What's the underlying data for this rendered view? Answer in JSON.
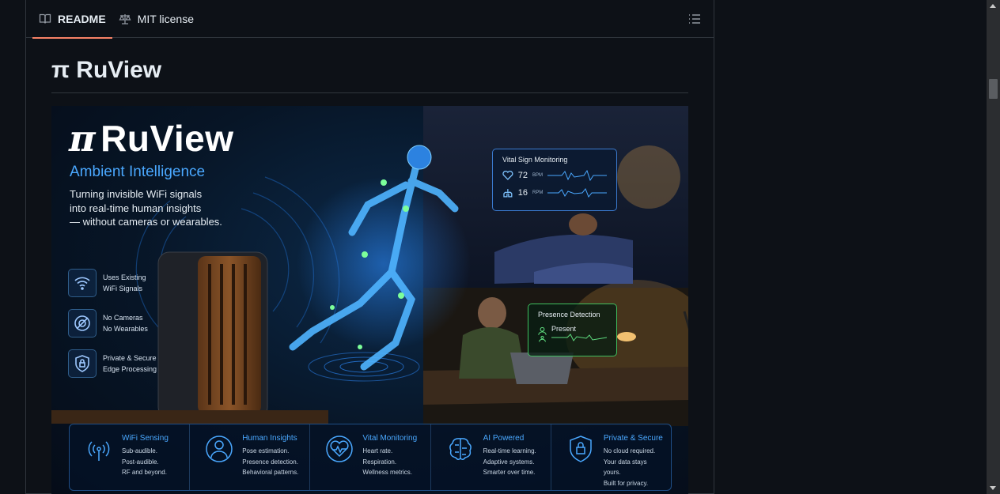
{
  "tabs": [
    {
      "label": "README",
      "icon": "book-icon",
      "active": true
    },
    {
      "label": "MIT license",
      "icon": "scale-icon",
      "active": false
    }
  ],
  "toc_icon": "list-icon",
  "page_title": "π RuView",
  "hero": {
    "logo_pi": "π",
    "logo_text": "RuView",
    "subtitle": "Ambient Intelligence",
    "description": [
      "Turning invisible WiFi signals",
      "into real-time human insights",
      "— without cameras or wearables."
    ],
    "features": [
      {
        "icon": "wifi-icon",
        "line1": "Uses Existing",
        "line2": "WiFi Signals"
      },
      {
        "icon": "no-camera-icon",
        "line1": "No Cameras",
        "line2": "No Wearables"
      },
      {
        "icon": "lock-icon",
        "line1": "Private & Secure",
        "line2": "Edge Processing"
      }
    ],
    "vital_card": {
      "title": "Vital Sign Monitoring",
      "heart_value": "72",
      "heart_unit": "BPM",
      "resp_value": "16",
      "resp_unit": "RPM"
    },
    "presence_card": {
      "title": "Presence Detection",
      "status": "Present"
    },
    "bottom": [
      {
        "icon": "wifi-sensing-icon",
        "title": "WiFi Sensing",
        "lines": [
          "Sub-audible.",
          "Post-audible.",
          "RF and beyond."
        ]
      },
      {
        "icon": "person-icon",
        "title": "Human Insights",
        "lines": [
          "Pose estimation.",
          "Presence detection.",
          "Behavioral patterns."
        ]
      },
      {
        "icon": "heart-icon",
        "title": "Vital Monitoring",
        "lines": [
          "Heart rate.",
          "Respiration.",
          "Wellness metrics."
        ]
      },
      {
        "icon": "brain-icon",
        "title": "AI Powered",
        "lines": [
          "Real-time learning.",
          "Adaptive systems.",
          "Smarter over time."
        ]
      },
      {
        "icon": "shield-lock-icon",
        "title": "Private & Secure",
        "lines": [
          "No cloud required.",
          "Your data stays yours.",
          "Built for privacy."
        ]
      }
    ]
  },
  "colors": {
    "accent": "#f78166",
    "blue": "#4aa8ff",
    "green": "#3fbf5f",
    "bg": "#0d1117",
    "border": "#30363d"
  }
}
